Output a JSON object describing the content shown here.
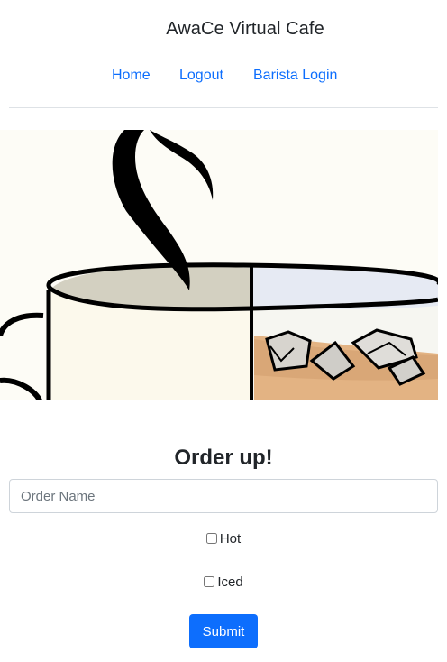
{
  "header": {
    "site_title": "AwaCe Virtual Cafe"
  },
  "nav": {
    "items": [
      {
        "label": "Home"
      },
      {
        "label": "Logout"
      },
      {
        "label": "Barista Login"
      }
    ]
  },
  "hero": {
    "image_icon": "hot-and-iced-coffee-cup-illustration"
  },
  "order_form": {
    "heading": "Order up!",
    "order_name_placeholder": "Order Name",
    "order_name_value": "",
    "hot_label": "Hot",
    "hot_checked": false,
    "iced_label": "Iced",
    "iced_checked": false,
    "submit_label": "Submit"
  },
  "colors": {
    "link": "#0d6efd",
    "button_bg": "#0d6efd",
    "button_text": "#ffffff",
    "divider": "#dee2e6",
    "text": "#212529"
  }
}
